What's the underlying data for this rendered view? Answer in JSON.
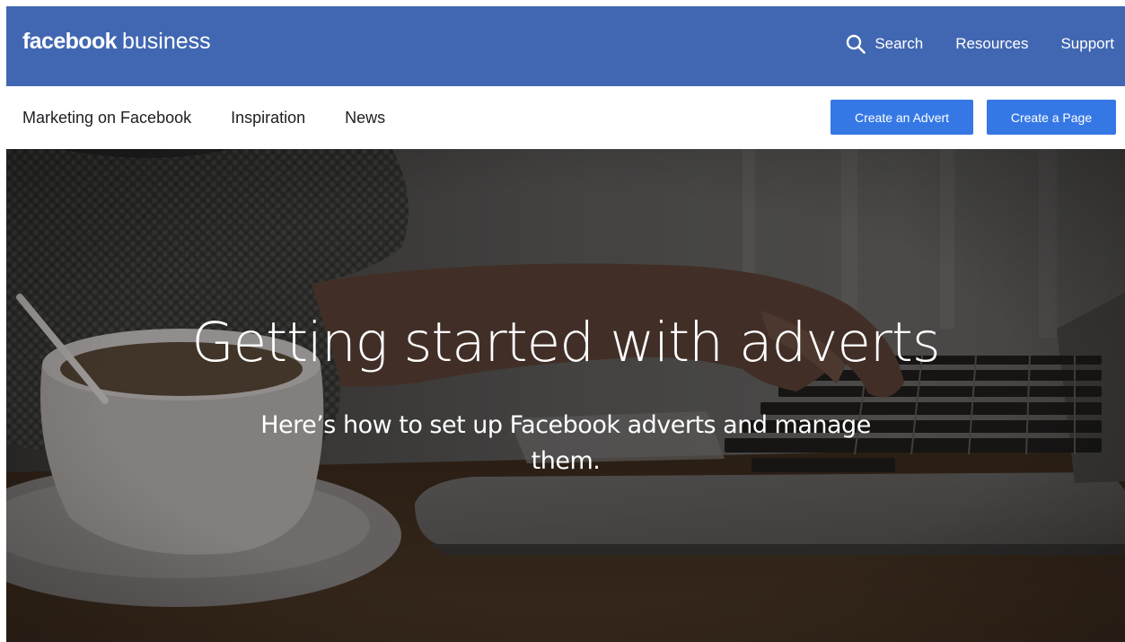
{
  "header": {
    "logo_brand": "facebook",
    "logo_product": "business",
    "nav": {
      "search_label": "Search",
      "resources_label": "Resources",
      "support_label": "Support"
    }
  },
  "subnav": {
    "items": [
      {
        "label": "Marketing on Facebook"
      },
      {
        "label": "Inspiration"
      },
      {
        "label": "News"
      }
    ],
    "create_advert_label": "Create an Advert",
    "create_page_label": "Create a Page"
  },
  "hero": {
    "title": "Getting started with adverts",
    "subtitle": "Here’s how to set up Facebook adverts and manage them."
  },
  "colors": {
    "brand_blue": "#4267b2",
    "button_blue": "#3578e5",
    "text_dark": "#1c1e21"
  },
  "icons": {
    "search": "search-icon"
  }
}
